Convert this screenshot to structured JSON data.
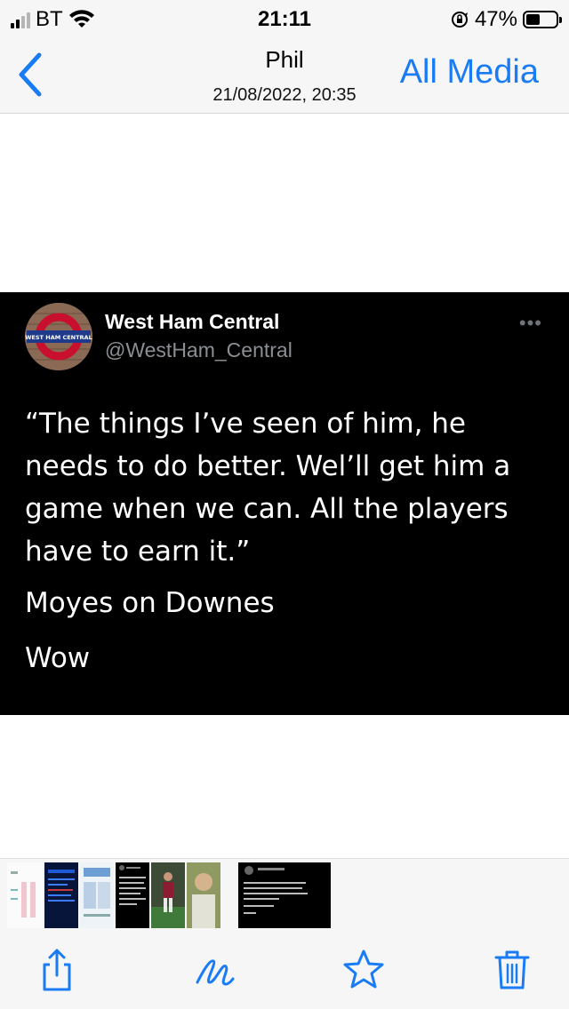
{
  "status_bar": {
    "carrier": "BT",
    "time": "21:11",
    "battery_percent": "47%",
    "battery_level": 0.47,
    "signal_bars_filled": 2,
    "signal_bars_total": 4
  },
  "nav": {
    "title": "Phil",
    "subtitle": "21/08/2022, 20:35",
    "all_media_label": "All Media",
    "accent_color": "#1a7cf5"
  },
  "tweet": {
    "display_name": "West Ham Central",
    "handle": "@WestHam_Central",
    "avatar_text": "WEST HAM CENTRAL",
    "body": "“The things I’ve seen of him, he needs to do better. Wel’ll get him a game when we can. All the players have to earn it.”",
    "line2": "Moyes on Downes",
    "line3": "Wow",
    "more_label": "•••"
  },
  "thumbnails": [
    {
      "name": "thumb-1",
      "kind": "white-doc"
    },
    {
      "name": "thumb-2",
      "kind": "blue-screenshot"
    },
    {
      "name": "thumb-3",
      "kind": "light-screenshot"
    },
    {
      "name": "thumb-4",
      "kind": "dark-text"
    },
    {
      "name": "thumb-5",
      "kind": "football-player"
    },
    {
      "name": "thumb-6",
      "kind": "photo-person"
    },
    {
      "name": "thumb-7",
      "kind": "current-tweet"
    }
  ],
  "toolbar": {
    "icons": [
      "share-icon",
      "markup-icon",
      "favorite-star-icon",
      "trash-icon"
    ]
  }
}
